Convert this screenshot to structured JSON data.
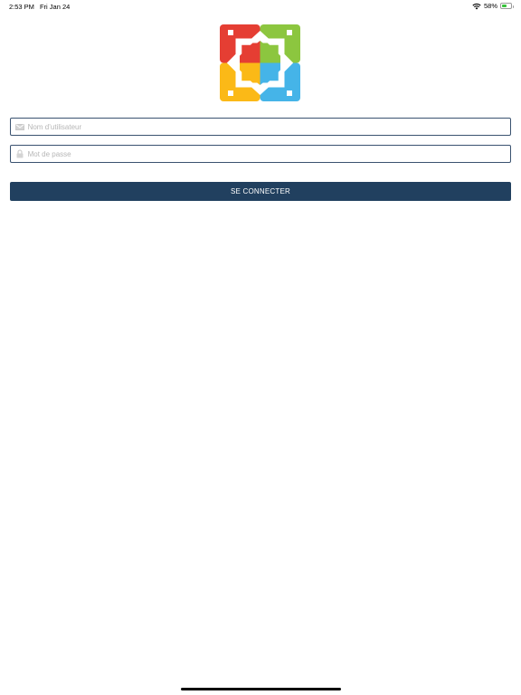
{
  "status_bar": {
    "time": "2:53 PM",
    "date": "Fri Jan 24",
    "battery": "58%",
    "battery_level": 0.58,
    "wifi_icon": "wifi-icon",
    "battery_icon": "battery-icon"
  },
  "logo": {
    "icon": "app-logo",
    "colors": {
      "red": "#e53e33",
      "green": "#8cc63f",
      "yellow": "#fbb917",
      "blue": "#45b4e8"
    }
  },
  "form": {
    "username": {
      "placeholder": "Nom d’utilisateur",
      "value": "",
      "icon": "envelope-icon"
    },
    "password": {
      "placeholder": "Mot de passe",
      "value": "",
      "icon": "lock-icon"
    },
    "submit_label": "SE CONNECTER"
  },
  "theme": {
    "accent": "#21405f",
    "field_border": "#3a5270"
  }
}
